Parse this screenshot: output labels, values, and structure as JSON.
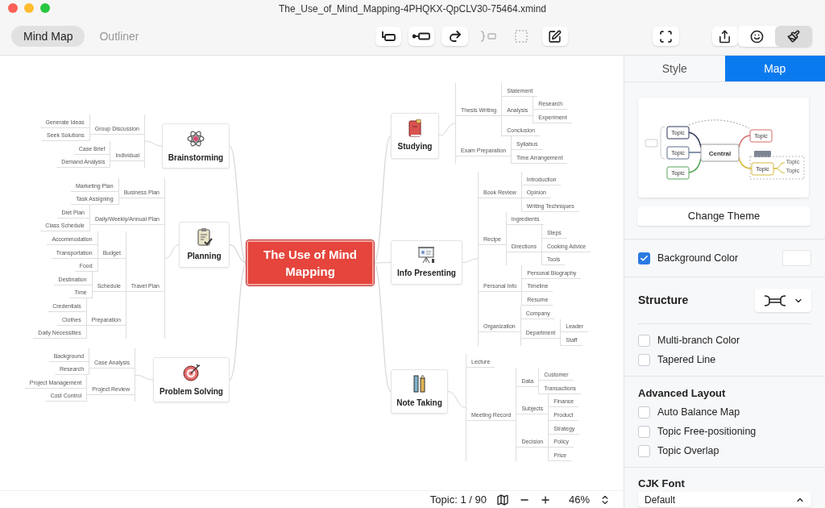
{
  "window": {
    "title": "The_Use_of_Mind_Mapping-4PHQKX-QpCLV30-75464.xmind"
  },
  "view_tabs": [
    {
      "label": "Mind Map",
      "selected": true
    },
    {
      "label": "Outliner",
      "selected": false
    }
  ],
  "tools": [
    {
      "kind": "topic",
      "disabled": false
    },
    {
      "kind": "subtopic",
      "disabled": false
    },
    {
      "kind": "relationship",
      "disabled": false
    },
    {
      "kind": "boundary",
      "disabled": true
    },
    {
      "kind": "summary",
      "disabled": true
    },
    {
      "kind": "note",
      "disabled": false
    },
    {
      "kind": "fullscreen",
      "disabled": false
    },
    {
      "kind": "share",
      "disabled": false
    }
  ],
  "panel_toggles": [
    {
      "kind": "emoji",
      "selected": false
    },
    {
      "kind": "format",
      "selected": true
    }
  ],
  "mind_map": {
    "central": "The Use of Mind Mapping",
    "topics": [
      {
        "label": "Brainstorming",
        "children": [
          {
            "label": "Group Discussion",
            "children": [
              {
                "label": "Generate Ideas"
              },
              {
                "label": "Seek Solutions"
              }
            ]
          },
          {
            "label": "Individual",
            "children": [
              {
                "label": "Case Brief"
              },
              {
                "label": "Demand Analysis"
              }
            ]
          }
        ]
      },
      {
        "label": "Planning",
        "children": [
          {
            "label": "Business Plan",
            "children": [
              {
                "label": "Marketing Plan"
              },
              {
                "label": "Task Assigning"
              }
            ]
          },
          {
            "label": "Daily/Weekly/Annual Plan",
            "children": [
              {
                "label": "Diet Plan"
              },
              {
                "label": "Class Schedule"
              }
            ]
          },
          {
            "label": "Travel Plan",
            "children": [
              {
                "label": "Budget",
                "children": [
                  {
                    "label": "Accommodation"
                  },
                  {
                    "label": "Transportation"
                  },
                  {
                    "label": "Food"
                  }
                ]
              },
              {
                "label": "Schedule",
                "children": [
                  {
                    "label": "Destination"
                  },
                  {
                    "label": "Time"
                  }
                ]
              },
              {
                "label": "Preparation",
                "children": [
                  {
                    "label": "Credentials"
                  },
                  {
                    "label": "Clothes"
                  },
                  {
                    "label": "Daily Necessities"
                  }
                ]
              }
            ]
          }
        ]
      },
      {
        "label": "Problem Solving",
        "children": [
          {
            "label": "Case Analysis",
            "children": [
              {
                "label": "Background"
              },
              {
                "label": "Research"
              }
            ]
          },
          {
            "label": "Project Review",
            "children": [
              {
                "label": "Project Management"
              },
              {
                "label": "Cost Control"
              }
            ]
          }
        ]
      },
      {
        "label": "Studying",
        "children": [
          {
            "label": "Thesis Writing",
            "children": [
              {
                "label": "Statement"
              },
              {
                "label": "Analysis",
                "children": [
                  {
                    "label": "Research"
                  },
                  {
                    "label": "Experiment"
                  }
                ]
              },
              {
                "label": "Conclusion"
              }
            ]
          },
          {
            "label": "Exam Preparation",
            "children": [
              {
                "label": "Syllabus"
              },
              {
                "label": "Time Arrangement"
              }
            ]
          }
        ]
      },
      {
        "label": "Info Presenting",
        "children": [
          {
            "label": "Book Review",
            "children": [
              {
                "label": "Introduction"
              },
              {
                "label": "Opinion"
              },
              {
                "label": "Writing Techniques"
              }
            ]
          },
          {
            "label": "Recipe",
            "children": [
              {
                "label": "Ingredients"
              },
              {
                "label": "Directions",
                "children": [
                  {
                    "label": "Steps"
                  },
                  {
                    "label": "Cooking Advice"
                  },
                  {
                    "label": "Tools"
                  }
                ]
              }
            ]
          },
          {
            "label": "Personal Info",
            "children": [
              {
                "label": "Personal Biography"
              },
              {
                "label": "Timeline"
              },
              {
                "label": "Resume"
              }
            ]
          },
          {
            "label": "Organization",
            "children": [
              {
                "label": "Company"
              },
              {
                "label": "Department",
                "children": [
                  {
                    "label": "Leader"
                  },
                  {
                    "label": "Staff"
                  }
                ]
              }
            ]
          }
        ]
      },
      {
        "label": "Note Taking",
        "children": [
          {
            "label": "Lecture"
          },
          {
            "label": "Meeting Record",
            "children": [
              {
                "label": "Data",
                "children": [
                  {
                    "label": "Customer"
                  },
                  {
                    "label": "Transactions"
                  }
                ]
              },
              {
                "label": "Subjects",
                "children": [
                  {
                    "label": "Finance"
                  },
                  {
                    "label": "Product"
                  }
                ]
              },
              {
                "label": "Decision",
                "children": [
                  {
                    "label": "Strategy"
                  },
                  {
                    "label": "Policy"
                  },
                  {
                    "label": "Price"
                  }
                ]
              }
            ]
          }
        ]
      }
    ]
  },
  "status_bar": {
    "topic_count": "Topic: 1 / 90",
    "zoom": "46%"
  },
  "panel": {
    "tabs": [
      {
        "label": "Style",
        "selected": false
      },
      {
        "label": "Map",
        "selected": true
      }
    ],
    "theme_preview": {
      "central": "Central",
      "topics": [
        "Topic",
        "Topic",
        "Topic",
        "Topic",
        "Topic"
      ],
      "subtopics": [
        "Topic",
        "Topic"
      ]
    },
    "change_theme": "Change Theme",
    "background_color": {
      "label": "Background Color",
      "checked": true
    },
    "structure": "Structure",
    "options": [
      {
        "label": "Multi-branch Color",
        "checked": false
      },
      {
        "label": "Tapered Line",
        "checked": false
      }
    ],
    "advanced_layout": {
      "title": "Advanced Layout",
      "options": [
        {
          "label": "Auto Balance Map",
          "checked": false
        },
        {
          "label": "Topic Free-positioning",
          "checked": false
        },
        {
          "label": "Topic Overlap",
          "checked": false
        }
      ]
    },
    "cjk_font": {
      "title": "CJK Font",
      "value": "Default"
    }
  }
}
